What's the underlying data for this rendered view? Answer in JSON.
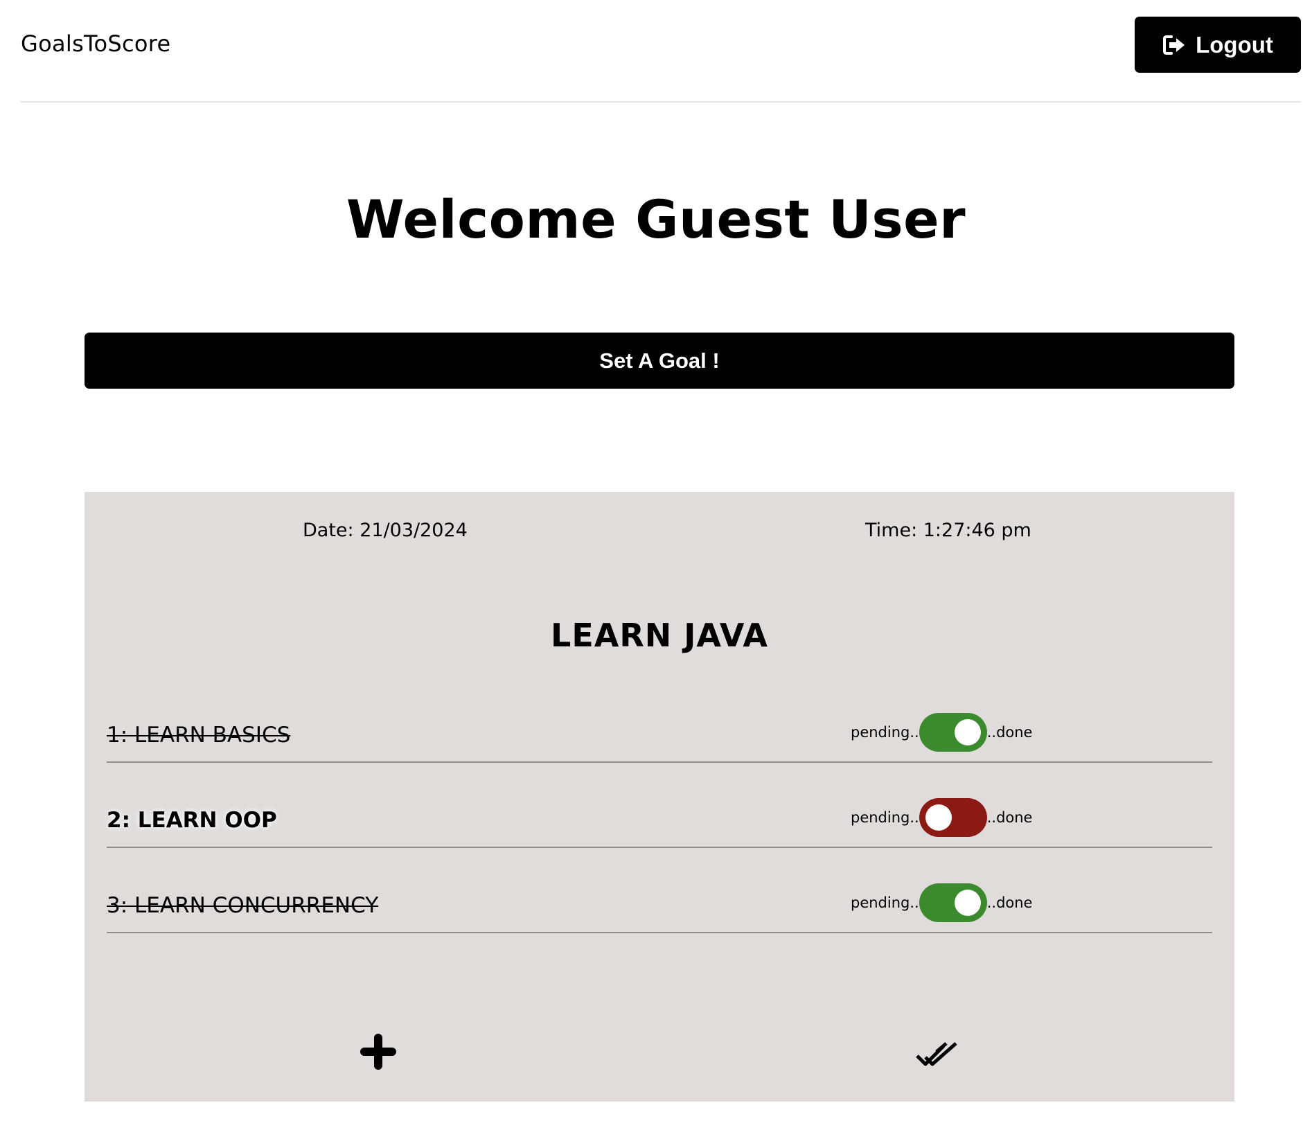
{
  "header": {
    "brand": "GoalsToScore",
    "logout_label": "Logout",
    "logout_icon": "sign-out-icon"
  },
  "welcome": "Welcome Guest User",
  "set_goal_label": "Set A Goal !",
  "goal_card": {
    "date": "Date: 21/03/2024",
    "time": "Time: 1:27:46 pm",
    "title": "LEARN JAVA",
    "tasks": [
      {
        "label": "1: LEARN BASICS",
        "status": "done",
        "toggle_color": "#3c8a2e"
      },
      {
        "label": "2: LEARN OOP",
        "status": "pending",
        "toggle_color": "#8c1a14"
      },
      {
        "label": "3: LEARN CONCURRENCY",
        "status": "done",
        "toggle_color": "#3c8a2e"
      }
    ],
    "toggle_left_text": "pending..",
    "toggle_right_text": "..done",
    "add_icon": "plus-icon",
    "complete_icon": "double-check-icon"
  },
  "colors": {
    "card_bg": "#dfdcdb",
    "done_green": "#3c8a2e",
    "pending_red": "#8c1a14",
    "button_bg": "#000000"
  }
}
